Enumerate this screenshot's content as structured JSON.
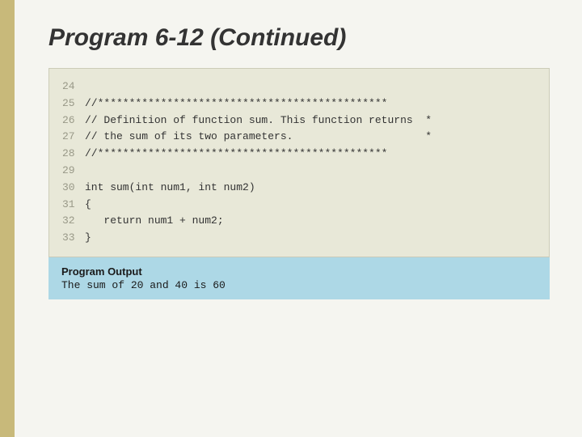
{
  "slide": {
    "title": "Program 6-12 (Continued)",
    "code": {
      "lines": [
        {
          "number": "24",
          "content": ""
        },
        {
          "number": "25",
          "content": "//**********************************************"
        },
        {
          "number": "26",
          "content": "// Definition of function sum. This function returns  *"
        },
        {
          "number": "27",
          "content": "// the sum of its two parameters.                     *"
        },
        {
          "number": "28",
          "content": "//**********************************************"
        },
        {
          "number": "29",
          "content": ""
        },
        {
          "number": "30",
          "content": "int sum(int num1, int num2)"
        },
        {
          "number": "31",
          "content": "{"
        },
        {
          "number": "32",
          "content": "   return num1 + num2;"
        },
        {
          "number": "33",
          "content": "}"
        }
      ]
    },
    "output": {
      "label": "Program Output",
      "text": "The sum of 20 and 40 is 60"
    }
  }
}
